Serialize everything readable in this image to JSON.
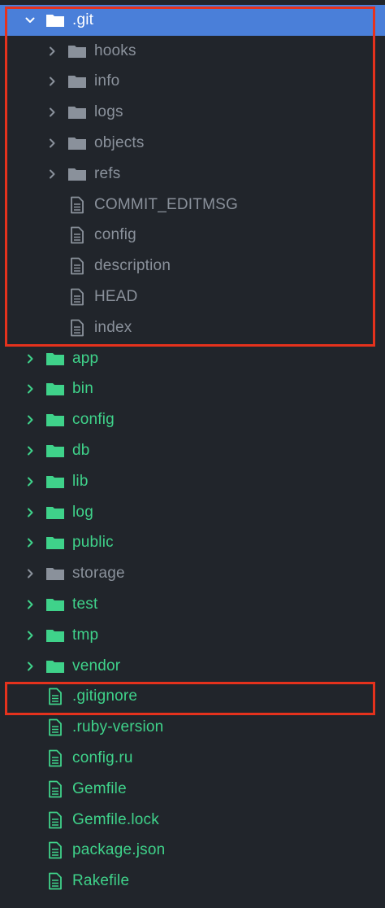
{
  "colors": {
    "background": "#21252b",
    "selected_row": "#4a7fd9",
    "tracked_green": "#3fd28a",
    "ignored_gray": "#8a919b",
    "highlight_red": "#e5321d"
  },
  "tree": {
    "root": {
      "label": ".git",
      "expanded": true,
      "selected": true,
      "icon": "folder-open-icon"
    },
    "git_children": [
      {
        "label": "hooks",
        "type": "folder",
        "icon": "folder-icon"
      },
      {
        "label": "info",
        "type": "folder",
        "icon": "folder-icon"
      },
      {
        "label": "logs",
        "type": "folder",
        "icon": "folder-icon"
      },
      {
        "label": "objects",
        "type": "folder",
        "icon": "folder-icon"
      },
      {
        "label": "refs",
        "type": "folder",
        "icon": "folder-icon"
      },
      {
        "label": "COMMIT_EDITMSG",
        "type": "file",
        "icon": "file-icon"
      },
      {
        "label": "config",
        "type": "file",
        "icon": "file-icon"
      },
      {
        "label": "description",
        "type": "file",
        "icon": "file-icon"
      },
      {
        "label": "HEAD",
        "type": "file",
        "icon": "file-icon"
      },
      {
        "label": "index",
        "type": "file",
        "icon": "file-icon"
      }
    ],
    "top_folders": [
      {
        "label": "app",
        "status": "tracked"
      },
      {
        "label": "bin",
        "status": "tracked"
      },
      {
        "label": "config",
        "status": "tracked"
      },
      {
        "label": "db",
        "status": "tracked"
      },
      {
        "label": "lib",
        "status": "tracked"
      },
      {
        "label": "log",
        "status": "tracked"
      },
      {
        "label": "public",
        "status": "tracked"
      },
      {
        "label": "storage",
        "status": "ignored"
      },
      {
        "label": "test",
        "status": "tracked"
      },
      {
        "label": "tmp",
        "status": "tracked"
      },
      {
        "label": "vendor",
        "status": "tracked"
      }
    ],
    "top_files": [
      {
        "label": ".gitignore",
        "highlighted": true
      },
      {
        "label": ".ruby-version"
      },
      {
        "label": "config.ru"
      },
      {
        "label": "Gemfile"
      },
      {
        "label": "Gemfile.lock"
      },
      {
        "label": "package.json"
      },
      {
        "label": "Rakefile"
      }
    ]
  }
}
